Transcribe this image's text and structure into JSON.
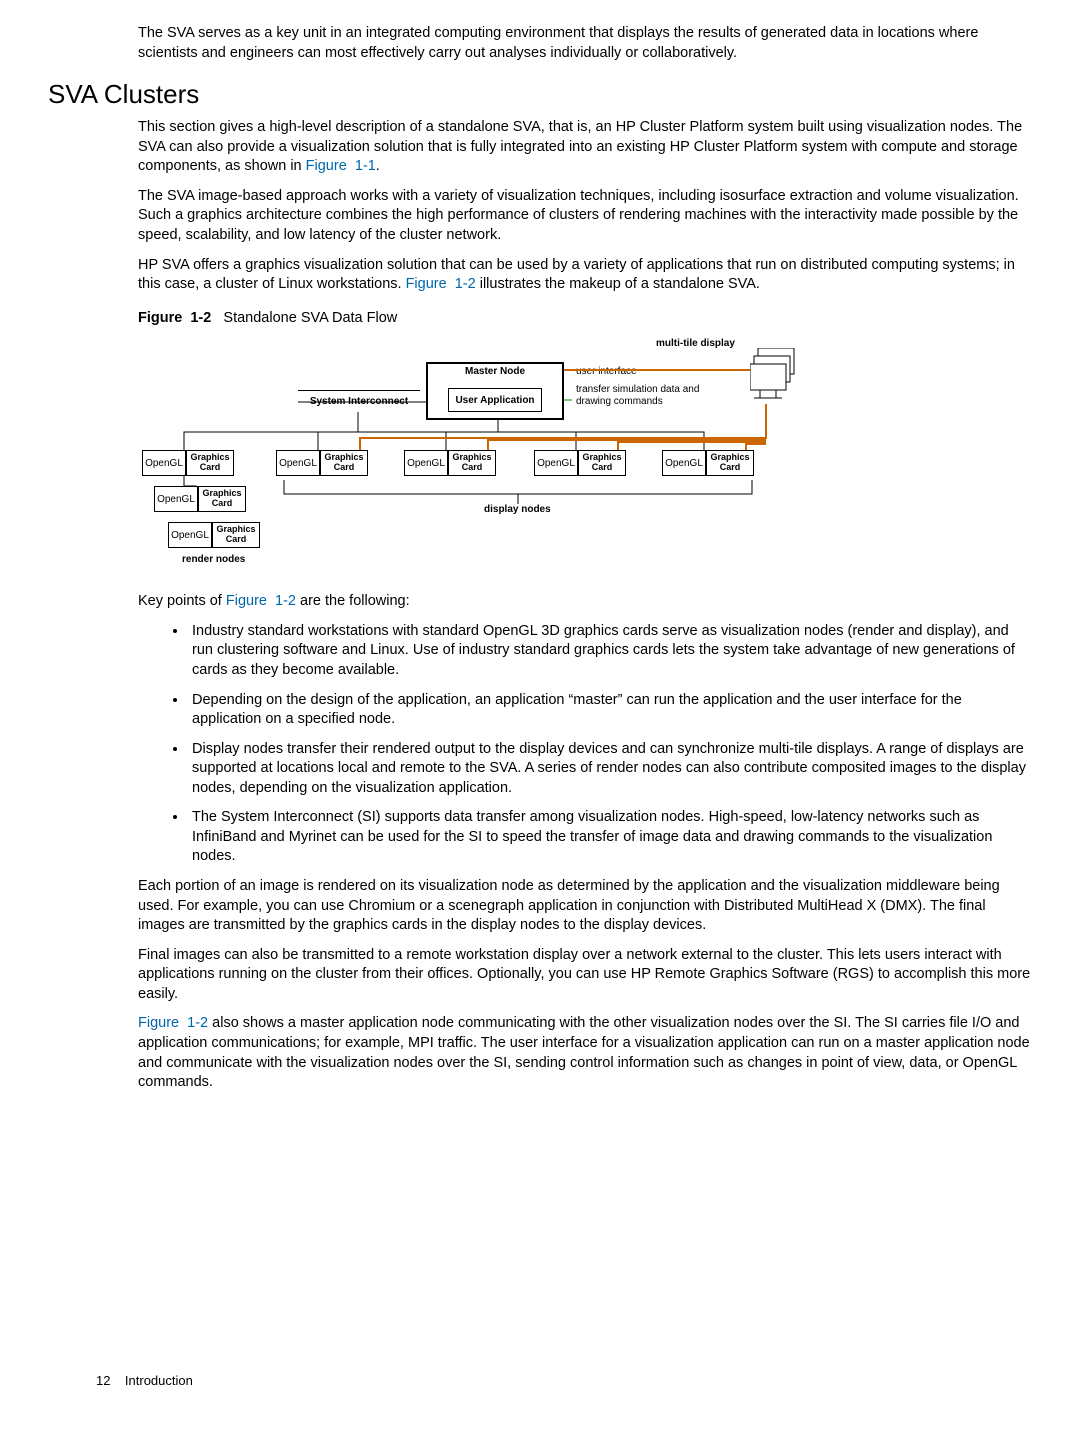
{
  "intro_para": "The SVA serves as a key unit in an integrated computing environment that displays the results of generated data in locations where scientists and engineers can most effectively carry out analyses individually or collaboratively.",
  "heading": "SVA Clusters",
  "p1a": "This section gives a high-level description of a standalone SVA, that is, an HP Cluster Platform system built using visualization nodes. The SVA can also provide a visualization solution that is fully integrated into an existing HP Cluster Platform system with compute and storage components, as shown in ",
  "p1_link": "Figure  1-1",
  "p1b": ".",
  "p2": "The SVA image-based approach works with a variety of visualization techniques, including isosurface extraction and volume visualization. Such a graphics architecture combines the high performance of clusters of rendering machines with the interactivity made possible by the speed, scalability, and low latency of the cluster network.",
  "p3a": "HP SVA offers a graphics visualization solution that can be used by a variety of applications that run on distributed computing systems; in this case, a cluster of Linux workstations. ",
  "p3_link": "Figure  1-2",
  "p3b": " illustrates the makeup of a standalone SVA.",
  "fig_label_bold": "Figure  1-2",
  "fig_label_rest": "   Standalone SVA Data Flow",
  "diagram": {
    "multi_tile": "multi-tile display",
    "master_node": "Master Node",
    "user_interface": "user interface",
    "user_app": "User Application",
    "transfer": "transfer simulation data and drawing commands",
    "sys_interconnect": "System Interconnect",
    "opengl": "OpenGL",
    "graphics_card": "Graphics Card",
    "display_nodes": "display nodes",
    "render_nodes": "render nodes"
  },
  "key_intro_a": "Key points of ",
  "key_intro_link": "Figure  1-2",
  "key_intro_b": " are the following:",
  "bullets": [
    "Industry standard workstations with standard OpenGL 3D graphics cards serve as visualization nodes (render and display), and run clustering software and Linux. Use of industry standard graphics cards lets the system take advantage of new generations of cards as they become available.",
    "Depending on the design of the application, an application “master” can run the application and the user interface for the application on a specified node.",
    "Display nodes transfer their rendered output to the display devices and can synchronize multi-tile displays. A range of displays are supported at locations local and remote to the SVA. A series of render nodes can also contribute composited images to the display nodes, depending on the visualization application.",
    "The System Interconnect (SI) supports data transfer among visualization nodes. High-speed, low-latency networks such as InfiniBand and Myrinet can be used for the SI to speed the transfer of image data and drawing commands to the visualization nodes."
  ],
  "p4": "Each portion of an image is rendered on its visualization node as determined by the application and the visualization middleware being used. For example, you can use Chromium or a scenegraph application in conjunction with Distributed MultiHead X (DMX). The final images are transmitted by the graphics cards in the display nodes to the display devices.",
  "p5": "Final images can also be transmitted to a remote workstation display over a network external to the cluster. This lets users interact with applications running on the cluster from their offices. Optionally, you can use HP Remote Graphics Software (RGS) to accomplish this more easily.",
  "p6_link": "Figure  1-2",
  "p6": " also shows a master application node communicating with the other visualization nodes over the SI. The SI carries file I/O and application communications; for example, MPI traffic. The user interface for a visualization application can run on a master application node and communicate with the visualization nodes over the SI, sending control information such as changes in point of view, data, or OpenGL commands.",
  "footer_page": "12",
  "footer_section": "Introduction"
}
